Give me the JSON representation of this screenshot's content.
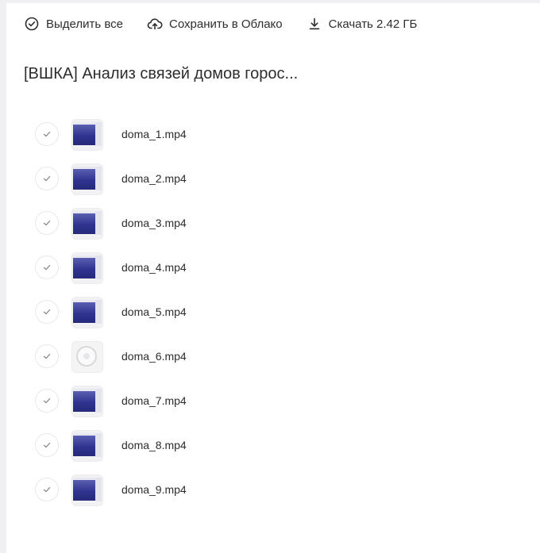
{
  "toolbar": {
    "select_all_label": "Выделить все",
    "save_to_cloud_label": "Сохранить в Облако",
    "download_label": "Скачать 2.42 ГБ"
  },
  "folder": {
    "title": "[ВШКА] Анализ связей домов горос..."
  },
  "files": [
    {
      "name": "doma_1.mp4",
      "thumb": "video-thumbnail"
    },
    {
      "name": "doma_2.mp4",
      "thumb": "video-thumbnail"
    },
    {
      "name": "doma_3.mp4",
      "thumb": "video-thumbnail"
    },
    {
      "name": "doma_4.mp4",
      "thumb": "video-thumbnail"
    },
    {
      "name": "doma_5.mp4",
      "thumb": "video-thumbnail"
    },
    {
      "name": "doma_6.mp4",
      "thumb": "video-thumbnail-light"
    },
    {
      "name": "doma_7.mp4",
      "thumb": "video-thumbnail"
    },
    {
      "name": "doma_8.mp4",
      "thumb": "video-thumbnail"
    },
    {
      "name": "doma_9.mp4",
      "thumb": "video-thumbnail"
    }
  ],
  "colors": {
    "text": "#2c2d2e",
    "check_border": "#e7e8ea",
    "check_mark": "#8c8c8f",
    "background": "#f0f0f2"
  }
}
